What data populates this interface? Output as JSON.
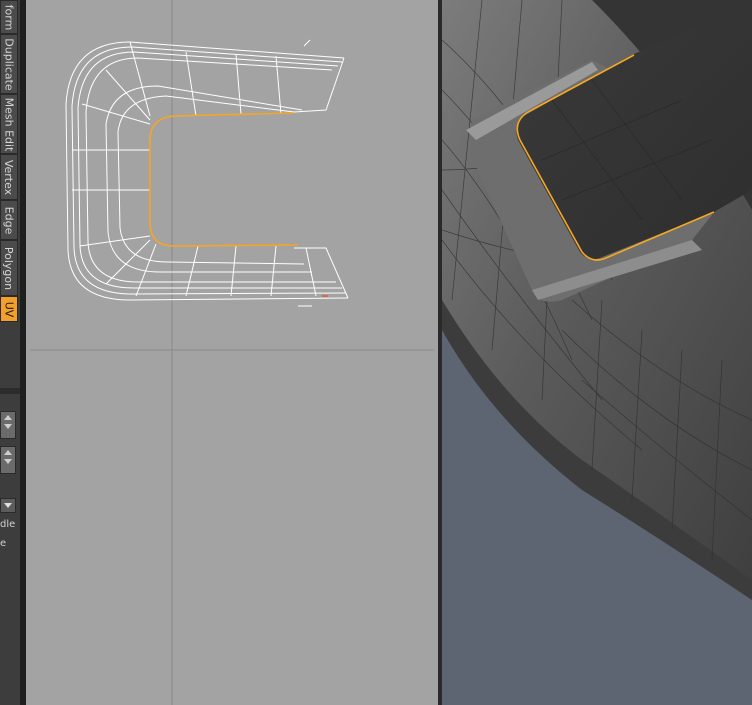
{
  "toolbar": {
    "tabs": [
      {
        "label": "form",
        "active": false
      },
      {
        "label": "Duplicate",
        "active": false
      },
      {
        "label": "Mesh Edit",
        "active": false
      },
      {
        "label": "Vertex",
        "active": false
      },
      {
        "label": "Edge",
        "active": false
      },
      {
        "label": "Polygon",
        "active": false
      },
      {
        "label": "UV",
        "active": true
      }
    ],
    "fragment_1": "dle",
    "fragment_2": "e"
  },
  "colors": {
    "accent": "#f2a02a",
    "uv_background": "#a3a3a3",
    "viewport_background": "#5d6572",
    "selection_edge": "#f5a623"
  },
  "icons": {
    "spinner_1": "spinner-arrows-icon",
    "spinner_2": "spinner-arrows-icon",
    "dropdown": "chevron-down-icon"
  }
}
